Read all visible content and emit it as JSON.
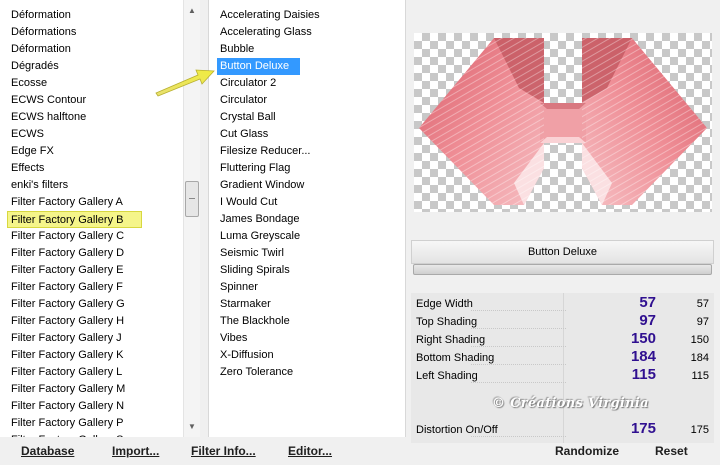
{
  "categories": [
    "Déformation",
    "Déformations",
    "Déformation",
    "Dégradés",
    "Ecosse",
    "ECWS Contour",
    "ECWS halftone",
    "ECWS",
    "Edge FX",
    "Effects",
    "enki's filters",
    "Filter Factory Gallery A",
    "Filter Factory Gallery B",
    "Filter Factory Gallery C",
    "Filter Factory Gallery D",
    "Filter Factory Gallery E",
    "Filter Factory Gallery F",
    "Filter Factory Gallery G",
    "Filter Factory Gallery H",
    "Filter Factory Gallery J",
    "Filter Factory Gallery K",
    "Filter Factory Gallery L",
    "Filter Factory Gallery M",
    "Filter Factory Gallery N",
    "Filter Factory Gallery P",
    "Filter Factory Gallery S"
  ],
  "selected_category_index": 12,
  "filters": [
    "Accelerating Daisies",
    "Accelerating Glass",
    "Bubble",
    "Button Deluxe",
    "Circulator 2",
    "Circulator",
    "Crystal Ball",
    "Cut Glass",
    "Filesize Reducer...",
    "Fluttering Flag",
    "Gradient Window",
    "I Would Cut",
    "James Bondage",
    "Luma Greyscale",
    "Seismic Twirl",
    "Sliding Spirals",
    "Spinner",
    "Starmaker",
    "The Blackhole",
    "Vibes",
    "X-Diffusion",
    "Zero Tolerance"
  ],
  "selected_filter_index": 3,
  "filter_name": "Button Deluxe",
  "parameters": [
    {
      "label": "Edge Width",
      "value": "57",
      "num": "57"
    },
    {
      "label": "Top Shading",
      "value": "97",
      "num": "97"
    },
    {
      "label": "Right Shading",
      "value": "150",
      "num": "150"
    },
    {
      "label": "Bottom Shading",
      "value": "184",
      "num": "184"
    },
    {
      "label": "Left Shading",
      "value": "115",
      "num": "115"
    },
    {
      "label": "Distortion On/Off",
      "value": "175",
      "num": "175"
    }
  ],
  "watermark": "© Créations Virginia",
  "buttons": {
    "database": "Database",
    "import": "Import...",
    "filter_info": "Filter Info...",
    "editor": "Editor...",
    "randomize": "Randomize",
    "reset": "Reset"
  },
  "colors": {
    "selected_category_bg": "#f5f58a",
    "selected_filter_bg": "#3399ff",
    "value_color": "#301090",
    "preview_pink": "#e8808a"
  }
}
